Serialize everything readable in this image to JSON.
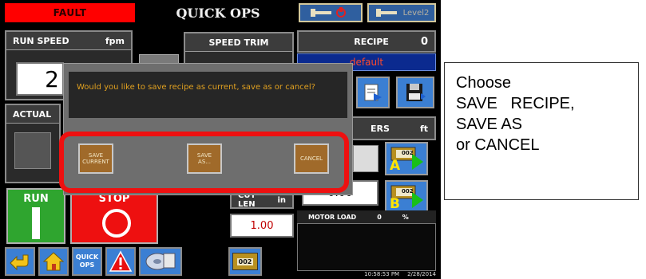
{
  "status": {
    "fault_label": "FAULT",
    "screen_title": "QUICK OPS",
    "level_label": "Level2"
  },
  "run_speed": {
    "label": "RUN SPEED",
    "unit": "fpm",
    "value": "2"
  },
  "speed_trim": {
    "label": "SPEED TRIM"
  },
  "actual": {
    "label": "ACTUAL"
  },
  "recipe": {
    "label": "RECIPE",
    "number": "0",
    "name": "default"
  },
  "counters": {
    "label": "ERS",
    "unit": "ft",
    "value_b": "0.00"
  },
  "cut_length": {
    "label": "CUT LEN",
    "unit": "in",
    "value": "1.00"
  },
  "controls": {
    "run_label": "RUN",
    "stop_label": "STOP"
  },
  "motor_load": {
    "label": "MOTOR LOAD",
    "value": "0",
    "unit": "%"
  },
  "clock": {
    "time": "10:58:53 PM",
    "date": "2/28/2014"
  },
  "nav": {
    "quick_ops_line1": "QUICK",
    "quick_ops_line2": "OPS",
    "counter_label": "002"
  },
  "bin_a": {
    "label": "A",
    "badge": "002"
  },
  "bin_b": {
    "label": "B",
    "badge": "002"
  },
  "dialog": {
    "message": "Would you like to save recipe as current, save as or cancel?",
    "save_current_line1": "SAVE",
    "save_current_line2": "CURRENT",
    "save_as_line1": "SAVE",
    "save_as_line2": "AS...",
    "cancel_label": "CANCEL"
  },
  "callout": {
    "line1": "Choose",
    "line2": "SAVE   RECIPE,",
    "line3": "SAVE AS",
    "line4": "or CANCEL"
  },
  "colors": {
    "fault": "#ff0000",
    "run": "#2fa52f",
    "stop": "#ee1010",
    "highlight": "#ee1010",
    "dialog_button": "#a06a2a",
    "message": "#e0a020"
  }
}
